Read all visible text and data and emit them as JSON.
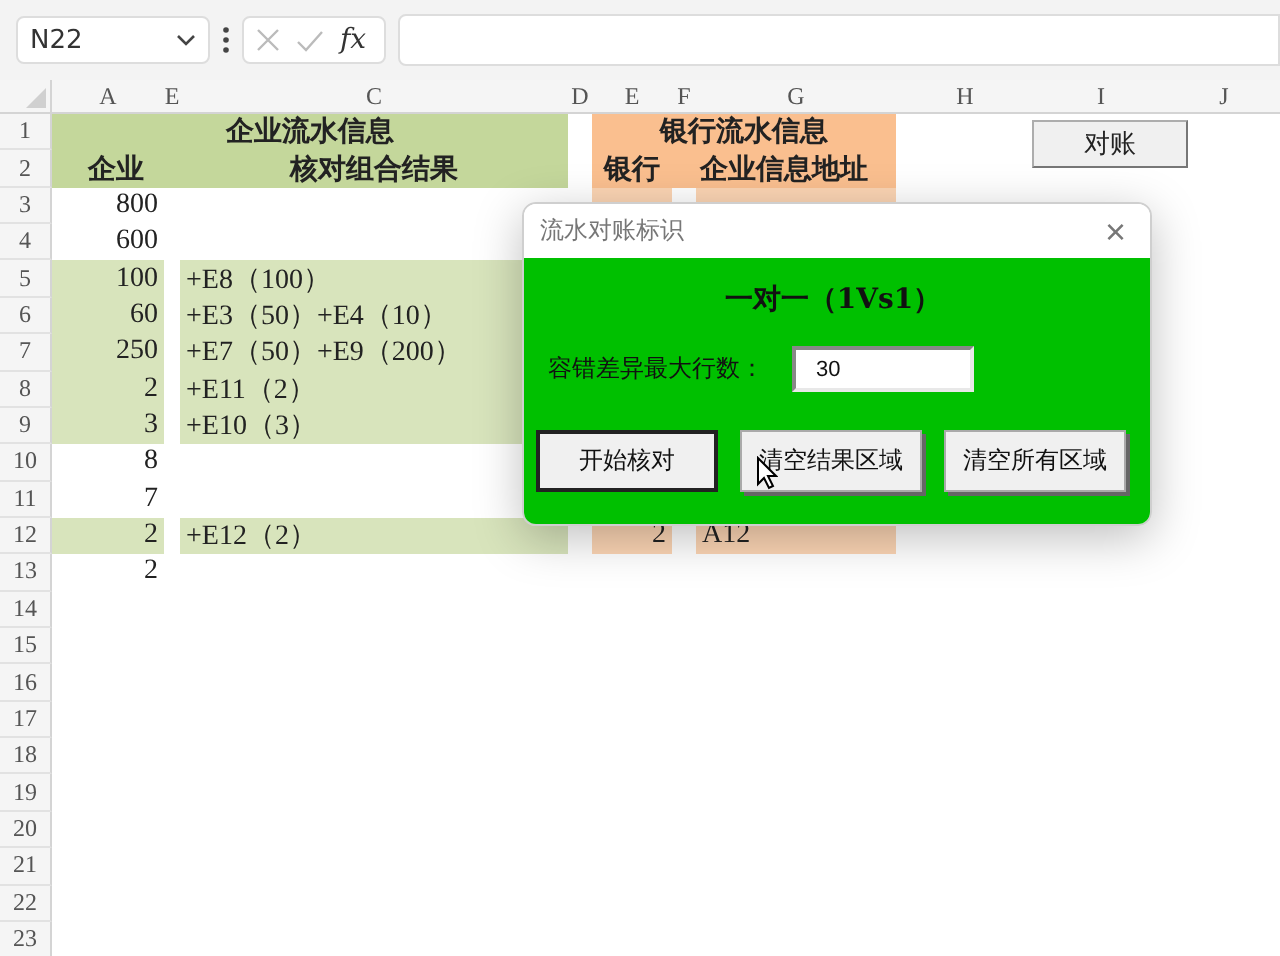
{
  "name_box": {
    "value": "N22"
  },
  "formula_bar": {
    "fx_label": "fx"
  },
  "columns": [
    "A",
    "E",
    "C",
    "D",
    "E",
    "F",
    "G",
    "H",
    "I",
    "J"
  ],
  "headers": {
    "enterprise_title": "企业流水信息",
    "enterprise_col": "企业",
    "result_col": "核对组合结果",
    "bank_title": "银行流水信息",
    "bank_col": "银行",
    "address_col": "企业信息地址"
  },
  "row_numbers": [
    "1",
    "2",
    "3",
    "4",
    "5",
    "6",
    "7",
    "8",
    "9",
    "10",
    "11",
    "12",
    "13",
    "14",
    "15",
    "16",
    "17",
    "18",
    "19",
    "20",
    "21",
    "22",
    "23"
  ],
  "rows": [
    {
      "enterprise": "800",
      "matched": false,
      "bank_region": true
    },
    {
      "enterprise": "600",
      "matched": false
    },
    {
      "enterprise": "100",
      "result": "+E8（100）",
      "matched": true
    },
    {
      "enterprise": "60",
      "result": "+E3（50）+E4（10）",
      "matched": true
    },
    {
      "enterprise": "250",
      "result": "+E7（50）+E9（200）",
      "matched": true
    },
    {
      "enterprise": "2",
      "result": "+E11（2）",
      "matched": true
    },
    {
      "enterprise": "3",
      "result": "+E10（3）",
      "matched": true
    },
    {
      "enterprise": "8",
      "matched": false
    },
    {
      "enterprise": "7",
      "matched": false
    },
    {
      "enterprise": "2",
      "result": "+E12（2）",
      "matched": true,
      "bank_region": true,
      "bank": "2",
      "address": "A12"
    },
    {
      "enterprise": "2",
      "matched": false,
      "bank_region": false
    }
  ],
  "sheet_button": {
    "label": "对账"
  },
  "dialog": {
    "title": "流水对账标识",
    "close": "×",
    "heading": "一对一（1Vs1）",
    "field_label": "容错差异最大行数：",
    "field_value": "30",
    "buttons": [
      {
        "label": "开始核对",
        "focused": true
      },
      {
        "label": "清空结果区域",
        "focused": false
      },
      {
        "label": "清空所有区域",
        "focused": false
      }
    ]
  }
}
